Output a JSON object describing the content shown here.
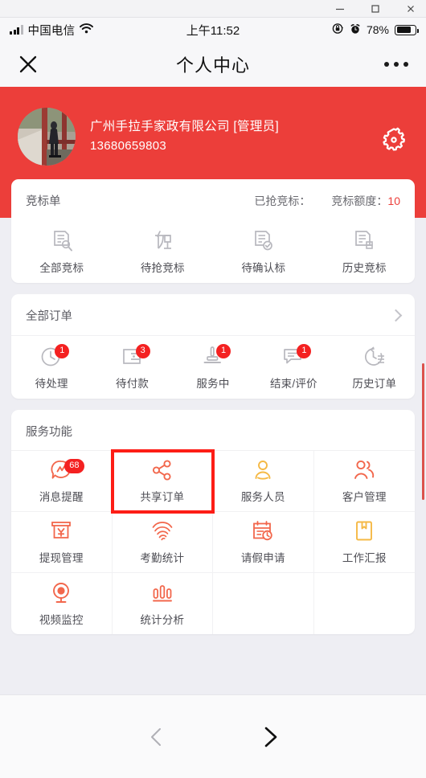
{
  "window": {
    "minimize_label": "minimize",
    "maximize_label": "maximize",
    "close_label": "close"
  },
  "status_bar": {
    "carrier": "中国电信",
    "wifi_icon": "wifi-icon",
    "signal_icon": "signal-bars-icon",
    "time": "上午11:52",
    "rotation_lock_icon": "rotation-lock-icon",
    "alarm_icon": "alarm-clock-icon",
    "battery_percent": "78%",
    "battery_icon": "battery-icon"
  },
  "nav_bar": {
    "close_icon": "close-icon",
    "title": "个人中心",
    "more_icon": "more-dots-icon"
  },
  "profile": {
    "avatar_alt": "user-avatar-photo",
    "name": "广州手拉手家政有限公司 [管理员]",
    "phone": "13680659803",
    "settings_icon": "gear-icon"
  },
  "bidding": {
    "title": "竞标单",
    "stat_grabbed_label": "已抢竞标：",
    "stat_grabbed_value": "",
    "stat_quota_label": "竞标额度：",
    "stat_quota_value": "10",
    "items": [
      {
        "label": "全部竞标",
        "icon": "document-search-icon"
      },
      {
        "label": "待抢竞标",
        "icon": "grab-bid-icon"
      },
      {
        "label": "待确认标",
        "icon": "document-check-icon"
      },
      {
        "label": "历史竞标",
        "icon": "document-history-icon"
      }
    ]
  },
  "orders": {
    "title": "全部订单",
    "chevron_icon": "chevron-right-icon",
    "items": [
      {
        "label": "待处理",
        "icon": "clock-icon",
        "badge": "1"
      },
      {
        "label": "待付款",
        "icon": "wallet-icon",
        "badge": "3"
      },
      {
        "label": "服务中",
        "icon": "mop-icon",
        "badge": "1"
      },
      {
        "label": "结束/评价",
        "icon": "comment-icon",
        "badge": "1"
      },
      {
        "label": "历史订单",
        "icon": "history-clock-icon",
        "badge": ""
      }
    ]
  },
  "services": {
    "title": "服务功能",
    "items": [
      {
        "label": "消息提醒",
        "icon": "message-alert-icon",
        "badge": "68",
        "color": "#f2674c",
        "highlighted": false
      },
      {
        "label": "共享订单",
        "icon": "share-nodes-icon",
        "badge": "",
        "color": "#f2674c",
        "highlighted": true
      },
      {
        "label": "服务人员",
        "icon": "user-staff-icon",
        "badge": "",
        "color": "#f5b945",
        "highlighted": false
      },
      {
        "label": "客户管理",
        "icon": "users-group-icon",
        "badge": "",
        "color": "#f2674c",
        "highlighted": false
      },
      {
        "label": "提现管理",
        "icon": "withdraw-yuan-icon",
        "badge": "",
        "color": "#f2674c",
        "highlighted": false
      },
      {
        "label": "考勤统计",
        "icon": "fingerprint-icon",
        "badge": "",
        "color": "#f2674c",
        "highlighted": false
      },
      {
        "label": "请假申请",
        "icon": "calendar-clock-icon",
        "badge": "",
        "color": "#f2674c",
        "highlighted": false
      },
      {
        "label": "工作汇报",
        "icon": "book-icon",
        "badge": "",
        "color": "#f5b945",
        "highlighted": false
      },
      {
        "label": "视频监控",
        "icon": "video-camera-icon",
        "badge": "",
        "color": "#f2674c",
        "highlighted": false
      },
      {
        "label": "统计分析",
        "icon": "bar-chart-icon",
        "badge": "",
        "color": "#f2674c",
        "highlighted": false
      }
    ]
  },
  "bottom_nav": {
    "back_icon": "chevron-left-icon",
    "forward_icon": "chevron-right-icon"
  },
  "colors": {
    "brand_red": "#ec3e3a",
    "badge_red": "#f42121",
    "highlight_red": "#fd1d16",
    "page_bg": "#eeeef3",
    "icon_gray": "#b8b8be",
    "icon_orange": "#f2674c",
    "icon_yellow": "#f5b945"
  }
}
